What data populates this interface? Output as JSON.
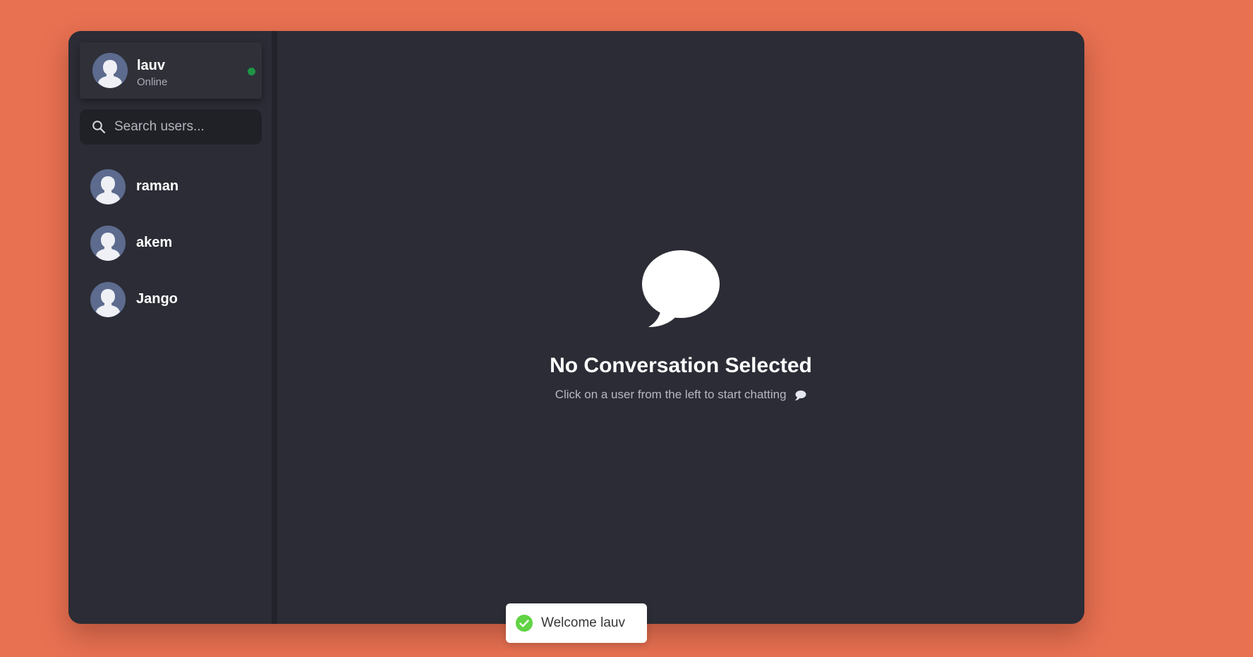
{
  "current_user": {
    "name": "lauv",
    "status": "Online",
    "status_color": "#1e9444",
    "avatar_icon": "default-user-avatar-icon"
  },
  "search": {
    "placeholder": "Search users...",
    "value": "",
    "icon": "search-icon"
  },
  "users": [
    {
      "name": "raman"
    },
    {
      "name": "akem"
    },
    {
      "name": "Jango"
    }
  ],
  "main": {
    "empty_title": "No Conversation Selected",
    "empty_subtitle": "Click on a user from the left to start chatting",
    "empty_icon": "chat-bubble-icon"
  },
  "toast": {
    "message": "Welcome lauv",
    "icon": "success-check-icon",
    "icon_color": "#61d345"
  },
  "colors": {
    "page_background": "#e87152",
    "app_background": "#2b2c35",
    "search_background": "#202126",
    "avatar_background": "#5c6b8e"
  }
}
